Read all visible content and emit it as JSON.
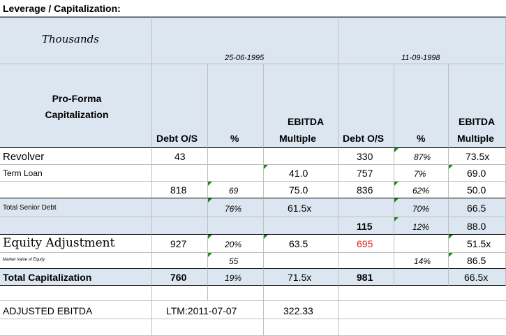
{
  "title": "Leverage / Capitalization:",
  "units": "Thousands",
  "dates": [
    "25-06-1995",
    "11-09-1998"
  ],
  "section_label": "Pro-Forma Capitalization",
  "headers": {
    "debt": "Debt O/S",
    "pct": "%",
    "ebitda_line1": "EBITDA",
    "ebitda_line2": "Multiple",
    "debt2": "Debt O/S",
    "pct2": "%",
    "ebitda2_line1": "EBITDA",
    "ebitda2_line2": "Multiple"
  },
  "rows": [
    {
      "label": "Revolver",
      "debt1": "43",
      "pct1": "",
      "mult1": "",
      "debt2": "330",
      "pct2": "87%",
      "mult2": "73.5x"
    },
    {
      "label": "Term Loan",
      "debt1": "",
      "pct1": "",
      "mult1": "41.0",
      "debt2": "757",
      "pct2": "7%",
      "mult2": "69.0"
    },
    {
      "label": "",
      "debt1": "818",
      "pct1": "69",
      "mult1": "75.0",
      "debt2": "836",
      "pct2": "62%",
      "mult2": "50.0"
    },
    {
      "label": "Total Senior Debt",
      "debt1": "",
      "pct1": "76%",
      "mult1": "61.5x",
      "debt2": "",
      "pct2": "70%",
      "mult2": "66.5"
    },
    {
      "label": "",
      "debt1": "",
      "pct1": "",
      "mult1": "",
      "debt2": "115",
      "pct2": "12%",
      "mult2": "88.0"
    },
    {
      "label": "Equity Adjustment",
      "debt1": "927",
      "pct1": "20%",
      "mult1": "63.5",
      "debt2": "695",
      "pct2": "",
      "mult2": "51.5x"
    },
    {
      "label": "Market Value of Equity",
      "debt1": "",
      "pct1": "55",
      "mult1": "",
      "debt2": "",
      "pct2": "14%",
      "mult2": "86.5"
    },
    {
      "label": "Total Capitalization",
      "debt1": "760",
      "pct1": "19%",
      "mult1": "71.5x",
      "debt2": "981",
      "pct2": "",
      "mult2": "66.5x"
    }
  ],
  "footer": {
    "label": "ADJUSTED EBITDA",
    "ltm": "LTM:2011-07-07",
    "value": "322.33"
  },
  "colors": {
    "header_fill": "#dce6f1",
    "marker": "#1a8a1a",
    "negative": "#e02020"
  }
}
